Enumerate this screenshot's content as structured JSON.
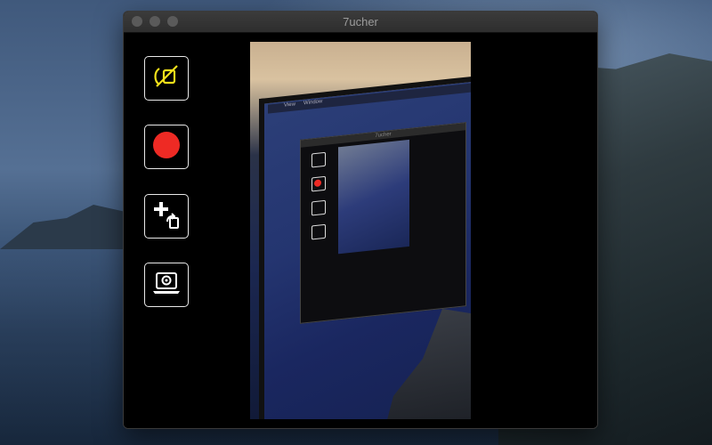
{
  "app": {
    "window_title": "7ucher"
  },
  "toolbar": {
    "buttons": [
      {
        "name": "mirror-toggle-button",
        "icon": "no-mirror-icon",
        "color": "#f2e01a"
      },
      {
        "name": "record-button",
        "icon": "record-icon",
        "color": "#ee2a24"
      },
      {
        "name": "add-overlay-button",
        "icon": "add-rotate-icon",
        "color": "#ffffff"
      },
      {
        "name": "camera-source-button",
        "icon": "laptop-camera-icon",
        "color": "#ffffff"
      }
    ]
  },
  "preview": {
    "inner_title": "7ucher",
    "inner_menu": [
      "View",
      "Window"
    ]
  },
  "colors": {
    "window_bg": "#000000",
    "button_border": "#e9e9e9",
    "accent_yellow": "#f2e01a",
    "record_red": "#ee2a24"
  }
}
